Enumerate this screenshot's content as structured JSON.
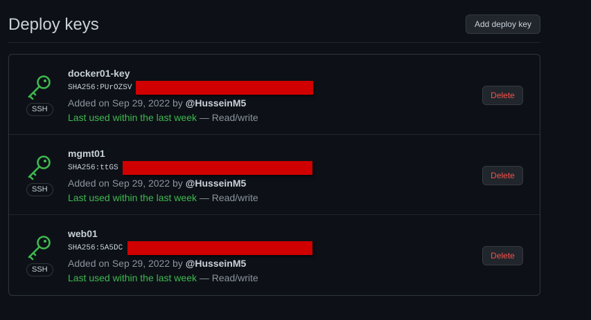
{
  "page": {
    "title": "Deploy keys",
    "add_button_label": "Add deploy key"
  },
  "colors": {
    "accent_green": "#3fb950",
    "danger_red": "#f85149",
    "redaction": "#d10000"
  },
  "keys": [
    {
      "icon": "key-icon",
      "badge": "SSH",
      "name": "docker01-key",
      "fingerprint": "SHA256:PUrOZSV",
      "added_prefix": "Added on Sep 29, 2022 by ",
      "added_by": "@HusseinM5",
      "last_used": "Last used within the last week",
      "access": " — Read/write",
      "delete_label": "Delete"
    },
    {
      "icon": "key-icon",
      "badge": "SSH",
      "name": "mgmt01",
      "fingerprint": "SHA256:ttGS",
      "added_prefix": "Added on Sep 29, 2022 by ",
      "added_by": "@HusseinM5",
      "last_used": "Last used within the last week",
      "access": " — Read/write",
      "delete_label": "Delete"
    },
    {
      "icon": "key-icon",
      "badge": "SSH",
      "name": "web01",
      "fingerprint": "SHA256:5A5DC",
      "added_prefix": "Added on Sep 29, 2022 by ",
      "added_by": "@HusseinM5",
      "last_used": "Last used within the last week",
      "access": " — Read/write",
      "delete_label": "Delete"
    }
  ]
}
